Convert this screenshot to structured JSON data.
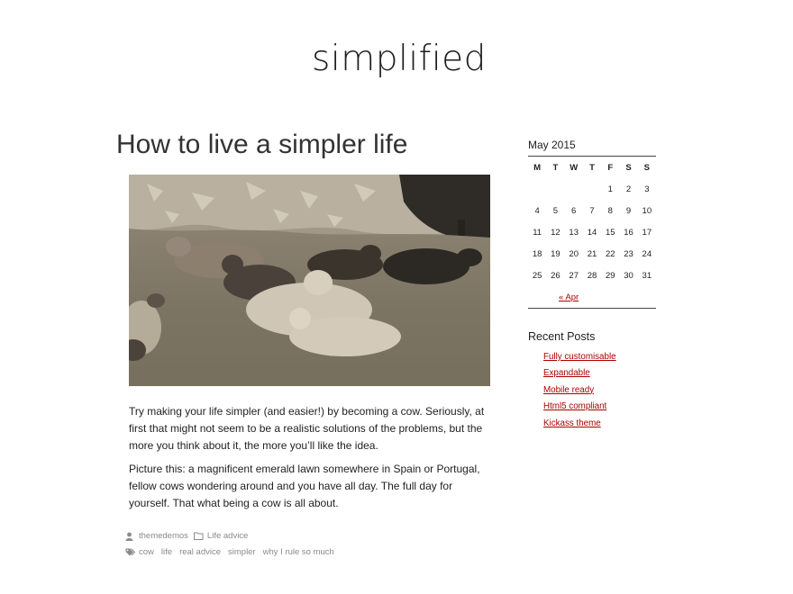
{
  "site": {
    "title": "simplified"
  },
  "post": {
    "title": "How to live a simpler life",
    "paragraphs": [
      "Try making your life simpler (and easier!) by becoming a cow. Seriously, at first that might not seem to be a realistic solutions of the problems, but the more you think about it, the more you’ll like the idea.",
      "Picture this: a magnificent emerald lawn somewhere in Spain or Portugal, fellow cows wondering around and you have all day. The full day for yourself. That what being a cow is all about."
    ],
    "author": "themedemos",
    "category": "Life advice",
    "tags": [
      "cow",
      "life",
      "real advice",
      "simpler",
      "why I rule so much"
    ]
  },
  "calendar": {
    "caption": "May 2015",
    "weekdays": [
      "M",
      "T",
      "W",
      "T",
      "F",
      "S",
      "S"
    ],
    "weeks": [
      [
        "",
        "",
        "",
        "",
        "1",
        "2",
        "3"
      ],
      [
        "4",
        "5",
        "6",
        "7",
        "8",
        "9",
        "10"
      ],
      [
        "11",
        "12",
        "13",
        "14",
        "15",
        "16",
        "17"
      ],
      [
        "18",
        "19",
        "20",
        "21",
        "22",
        "23",
        "24"
      ],
      [
        "25",
        "26",
        "27",
        "28",
        "29",
        "30",
        "31"
      ]
    ],
    "prev_link": "« Apr"
  },
  "recent_posts": {
    "title": "Recent Posts",
    "items": [
      "Fully customisable",
      "Expandable",
      "Mobile ready",
      "Html5 compliant",
      "Kickass theme"
    ]
  },
  "colors": {
    "link": "#a00000",
    "meta": "#8a8a8a",
    "text": "#222222"
  },
  "icons": {
    "author": "user-icon",
    "category": "folder-icon",
    "tags": "tags-icon"
  }
}
